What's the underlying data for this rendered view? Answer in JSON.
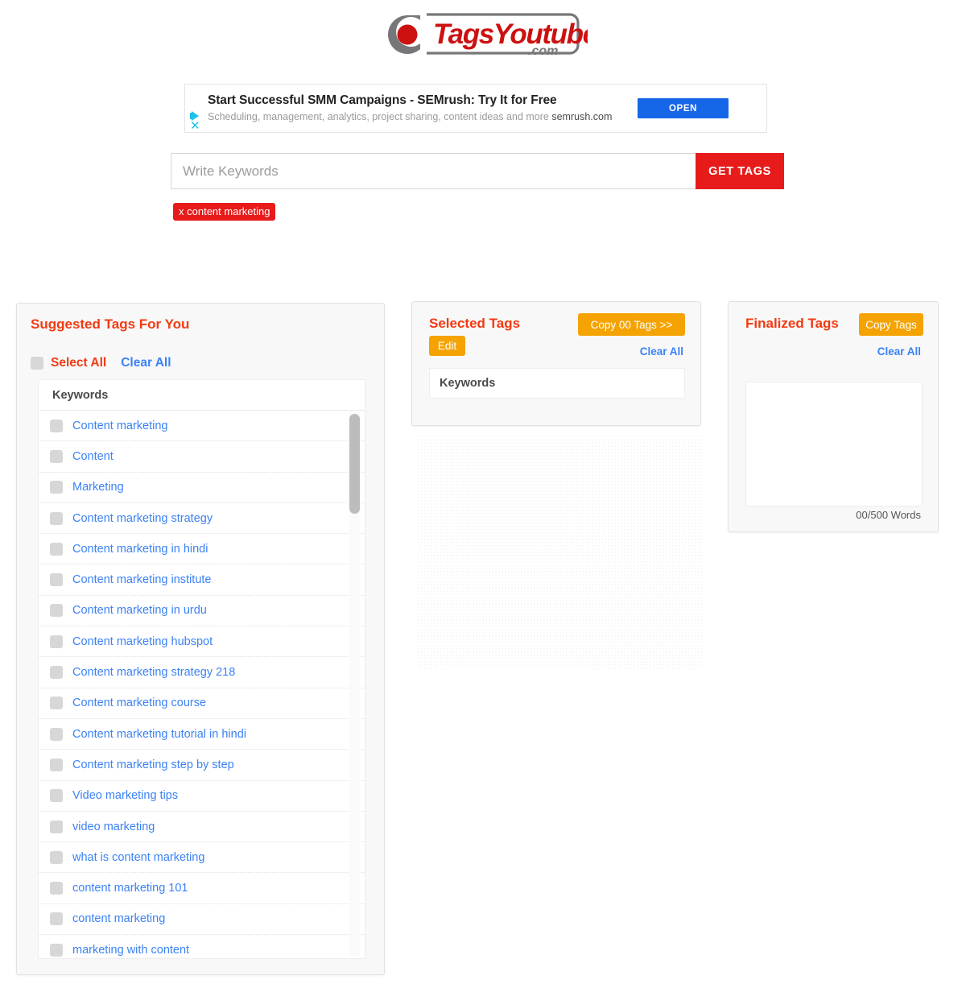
{
  "brand": {
    "name_part1": "Tags",
    "name_part2": "Youtube",
    "tld": ".com",
    "logo_icon": "camera-lens-record-icon",
    "color_red": "#cc1111",
    "color_grey": "#77777a"
  },
  "ad": {
    "adchoices_icon": "adchoices-triangle-icon",
    "close_icon": "close-x-icon",
    "title": "Start Successful SMM Campaigns - SEMrush: Try It for Free",
    "description": "Scheduling, management, analytics, project sharing, content ideas and more ",
    "domain": "semrush.com",
    "cta_label": "OPEN",
    "cta_color": "#1666e8"
  },
  "search": {
    "placeholder": "Write Keywords",
    "value": "",
    "button_label": "GET TAGS",
    "button_color": "#e81b1b"
  },
  "chips": [
    {
      "remove_icon": "x-remove-icon",
      "remove_label": "x",
      "label": "content marketing"
    }
  ],
  "suggested": {
    "title": "Suggested Tags For You",
    "select_all_label": "Select All",
    "clear_all_label": "Clear All",
    "table_header": "Keywords",
    "keywords": [
      "Content marketing",
      "Content",
      "Marketing",
      "Content marketing strategy",
      "Content marketing in hindi",
      "Content marketing institute",
      "Content marketing in urdu",
      "Content marketing hubspot",
      "Content marketing strategy 218",
      "Content marketing course",
      "Content marketing tutorial in hindi",
      "Content marketing step by step",
      "Video marketing tips",
      "video marketing",
      "what is content marketing",
      "content marketing 101",
      "content marketing",
      "marketing with content"
    ]
  },
  "selected": {
    "title": "Selected Tags",
    "copy_label": "Copy 00 Tags >>",
    "edit_label": "Edit",
    "clear_all_label": "Clear All",
    "box_label": "Keywords"
  },
  "finalized": {
    "title": "Finalized Tags",
    "copy_label": "Copy Tags",
    "clear_all_label": "Clear All",
    "textarea_value": "",
    "word_count": "00/500 Words"
  },
  "theme": {
    "accent_red": "#f23a12",
    "accent_orange": "#f5a302",
    "accent_blue": "#3b82f6"
  }
}
